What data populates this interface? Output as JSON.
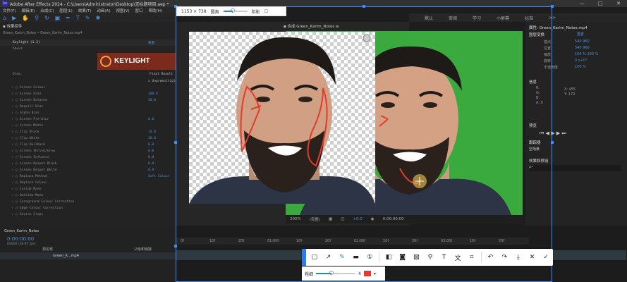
{
  "window": {
    "title": "Adobe After Effects 2024 - C:\\Users\\Administrator\\Desktop\\无标题项目.aep *",
    "controls": [
      "—",
      "□",
      "✕"
    ]
  },
  "menu": [
    "文件(F)",
    "编辑(E)",
    "合成(C)",
    "图层(L)",
    "效果(T)",
    "动画(A)",
    "视图(V)",
    "窗口",
    "帮助(H)"
  ],
  "workspace": {
    "items": [
      "默认",
      "审阅",
      "学习",
      "小屏幕",
      "标准",
      ">>"
    ]
  },
  "effects_panel": {
    "tab": "效果控件",
    "layer_path": "Green_Karim_Notes • Green_Karim_Notes.mp4",
    "effect_name": "Keylight (1.2)",
    "reset": "重置",
    "about": "About",
    "view_label": "View",
    "view_value": "Final Result",
    "rows": [
      {
        "label": "Screen Colour",
        "value": ""
      },
      {
        "label": "Screen Gain",
        "value": "100.0"
      },
      {
        "label": "Screen Balance",
        "value": "50.0"
      },
      {
        "label": "Despill Bias",
        "value": ""
      },
      {
        "label": "Alpha Bias",
        "value": ""
      },
      {
        "label": "Screen Pre-blur",
        "value": "0.0"
      },
      {
        "label": "Screen Matte",
        "value": ""
      },
      {
        "label": "Clip Black",
        "value": "14.0"
      },
      {
        "label": "Clip White",
        "value": "36.0"
      },
      {
        "label": "Clip Rollback",
        "value": "0.0"
      },
      {
        "label": "Screen Shrink/Grow",
        "value": "0.0"
      },
      {
        "label": "Screen Softness",
        "value": "0.0"
      },
      {
        "label": "Screen Despot Black",
        "value": "0.0"
      },
      {
        "label": "Screen Despot White",
        "value": "0.0"
      },
      {
        "label": "Replace Method",
        "value": "Soft Colour"
      },
      {
        "label": "Replace Colour",
        "value": ""
      },
      {
        "label": "Inside Mask",
        "value": ""
      },
      {
        "label": "Outside Mask",
        "value": ""
      },
      {
        "label": "Foreground Colour Correction",
        "value": ""
      },
      {
        "label": "Edge Colour Correction",
        "value": ""
      },
      {
        "label": "Source Crops",
        "value": ""
      }
    ],
    "logo_text": "KEYLIGHT",
    "unpremultiply": "Unpremultiply Result",
    "lock_biases": "Lock Biases Together"
  },
  "composition": {
    "tab": "合成 Green_Karim_Notes",
    "zoom": "200%",
    "quality": "(完整)",
    "exposure": "+0.0",
    "timecode": "0:00:00:00"
  },
  "properties": {
    "title": "属性: Green_Karim_Notes.mp4",
    "transform": "图层变换",
    "reset": "重置",
    "items": [
      {
        "label": "锚点",
        "values": "540   960"
      },
      {
        "label": "位置",
        "values": "540   960"
      },
      {
        "label": "缩放",
        "values": "100 %  100 %"
      },
      {
        "label": "旋转",
        "values": "0 x+0°"
      },
      {
        "label": "不透明度",
        "values": "100 %"
      }
    ],
    "info_title": "信息",
    "rgb": [
      "R:",
      "G:",
      "B:",
      "A: 0"
    ],
    "xy": [
      "X: 455",
      "Y: 170"
    ],
    "preview": "预览",
    "tracker": "跟踪器",
    "tracker_value": "空场景",
    "effects_presets": "效果和预设",
    "search_placeholder": "ρ•"
  },
  "timeline": {
    "tab": "Green_Karim_Notes",
    "timecode": "0:00:00:00",
    "frame_sub": "00000 (29.97 fps)",
    "source_name": "源名称",
    "parent": "父级和链接",
    "layer_name": "Green_K...mp4",
    "ticks": [
      "0f",
      "10f",
      "20f",
      "01:00f",
      "10f",
      "20f",
      "02:00f",
      "10f",
      "20f",
      "03:00f",
      "10f",
      "20f"
    ]
  },
  "capture": {
    "size": "1153 × 738",
    "brush_label": "圆角",
    "shadow_label": "阴影",
    "stroke_label": "粗细",
    "stroke_value": "4",
    "tools": [
      "shape",
      "arrow",
      "pen",
      "number",
      "mosaic",
      "blur",
      "highlight",
      "pin",
      "text",
      "ocr",
      "undo",
      "redo",
      "save",
      "cancel",
      "confirm"
    ],
    "brush_color": "#e23b2e",
    "accent": "#2b7de9"
  }
}
